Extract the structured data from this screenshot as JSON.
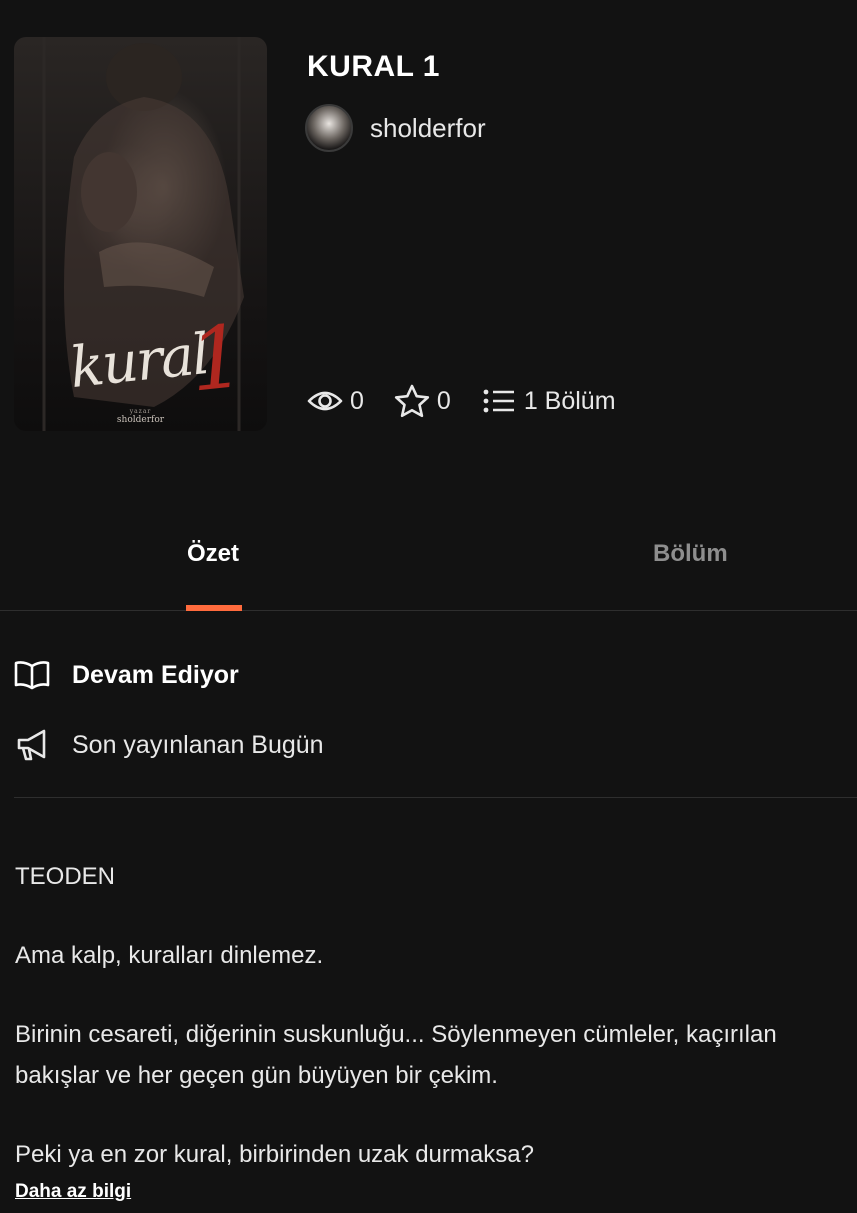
{
  "book": {
    "title": "KURAL 1",
    "cover": {
      "title_text": "kural",
      "number_text": "1",
      "byline_label": "yazar",
      "byline_author": "sholderfor"
    }
  },
  "author": {
    "name": "sholderfor",
    "avatar_icon": "avatar-icon"
  },
  "stats": {
    "views": "0",
    "votes": "0",
    "parts": "1 Bölüm"
  },
  "tabs": [
    {
      "label": "Özet",
      "active": true
    },
    {
      "label": "Bölüm",
      "active": false
    }
  ],
  "info": {
    "status": "Devam Ediyor",
    "published": "Son yayınlanan Bugün"
  },
  "summary": {
    "paragraphs": [
      "TEODEN",
      "Ama kalp, kuralları dinlemez.",
      "Birinin cesareti, diğerinin suskunluğu... Söylenmeyen cümleler, kaçırılan bakışlar ve her geçen gün büyüyen bir çekim.",
      "Peki ya en zor kural, birbirinden uzak durmaksa?"
    ],
    "toggle_label": "Daha az bilgi"
  },
  "colors": {
    "background": "#121212",
    "accent": "#ff6b3d",
    "inactive_tab": "#8e8e8e"
  }
}
